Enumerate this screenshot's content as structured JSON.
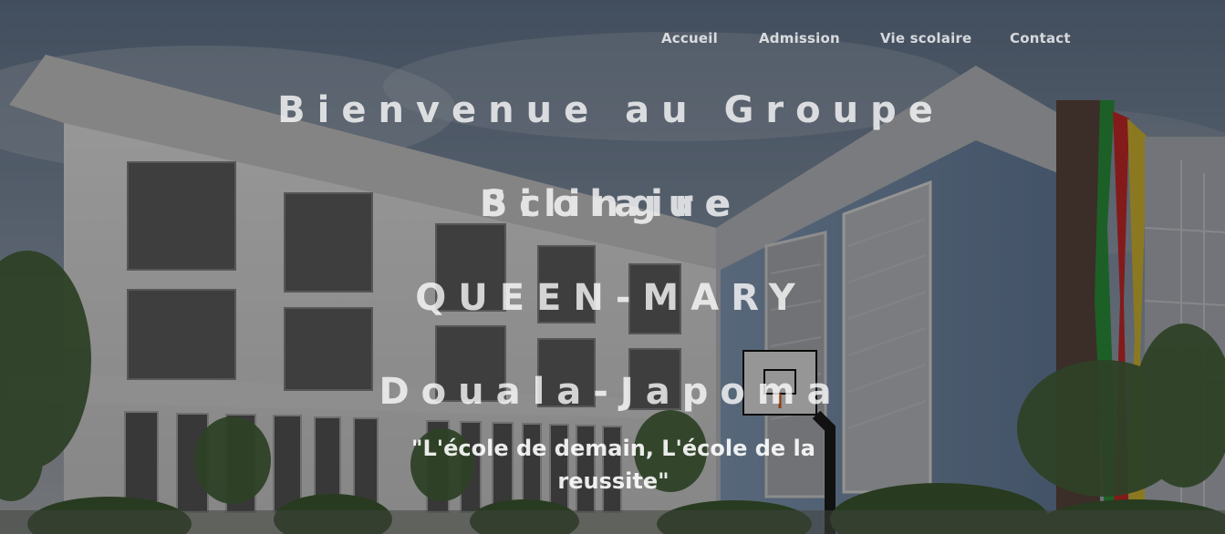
{
  "nav": {
    "items": [
      {
        "label": "Accueil"
      },
      {
        "label": "Admission"
      },
      {
        "label": "Vie scolaire"
      },
      {
        "label": "Contact"
      }
    ]
  },
  "hero": {
    "title_lines": [
      "Bienvenue au Groupe Scolaire",
      "Bilingue",
      "QUEEN-MARY",
      "Douala-Japoma"
    ],
    "tagline": "\"L'école de demain, L'école de la reussite\""
  },
  "colors": {
    "text": "#ffffff",
    "overlay": "rgba(0,0,0,0.38)",
    "flag_green": "#2f9b3f",
    "flag_red": "#d32d2d",
    "flag_yellow": "#e1c437"
  }
}
